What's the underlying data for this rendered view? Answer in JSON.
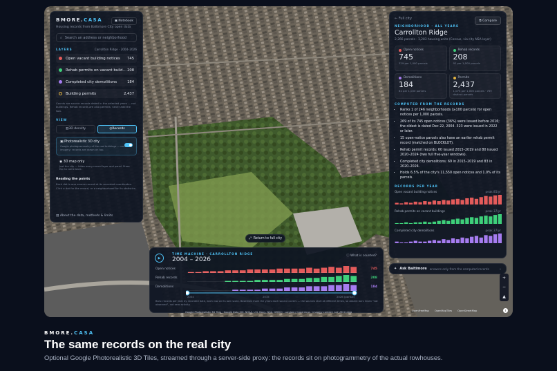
{
  "brand": {
    "first": "BMORE.",
    "second": "CASA"
  },
  "left_panel": {
    "notebook": "Notebook",
    "subtitle": "Housing records from Baltimore City open data",
    "search_placeholder": "Search an address or neighborhood",
    "layers_title": "LAYERS",
    "layers_scope": "Carrollton Ridge · 2004–2026",
    "layers": [
      {
        "label": "Open vacant building notices",
        "count": "745",
        "color": "#e45b5b"
      },
      {
        "label": "Rehab permits on vacant build…",
        "count": "208",
        "color": "#3ecf7a"
      },
      {
        "label": "Completed city demolitions",
        "count": "184",
        "color": "#a67cf0"
      },
      {
        "label": "Building permits",
        "count": "2,437",
        "color": "#e3b341"
      }
    ],
    "layers_note": "Counts are source records dated in the selected years — not buildings. Rehab records are also permits; never add the two.",
    "view_title": "VIEW",
    "view_tabs": [
      "3D density",
      "Records"
    ],
    "photo_title": "Photorealistic 3D city",
    "photo_desc": "Google photogrammetry of the real buildings — context imagery; records are drawn on top.",
    "map_only_title": "3D map only",
    "map_only_desc": "Just the city — hides every record layer and panel. Press Esc to come back.",
    "reading_title": "Reading the points",
    "reading_desc": "Each dot is one source record at its recorded coordinates. Click a dot for the record, or a neighborhood for its statistics.",
    "about": "About the data, methods & limits"
  },
  "right_panel": {
    "back": "Full city",
    "compare": "Compare",
    "tag": "NEIGHBORHOOD · ALL YEARS",
    "name": "Carrollton Ridge",
    "sub": "2,266 parcels · 1,283 housing units (Census, via city NSA layer)",
    "cards": [
      {
        "label": "Open notices",
        "value": "745",
        "sub": "329 per 1,000 parcels",
        "color": "#e45b5b"
      },
      {
        "label": "Rehab records",
        "value": "208",
        "sub": "92 per 1,000 parcels",
        "color": "#3ecf7a"
      },
      {
        "label": "Demolitions",
        "value": "184",
        "sub": "81 per 1,000 parcels",
        "color": "#a67cf0"
      },
      {
        "label": "Permits",
        "value": "2,437",
        "sub": "1,075 per 1,000 parcels · 769 distinct parcels",
        "color": "#e3b341"
      }
    ],
    "computed_title": "COMPUTED FROM THE RECORDS",
    "facts": [
      "Ranks 1 of 246 neighborhoods (≥100 parcels) for open notices per 1,000 parcels.",
      "269 of its 745 open notices (36%) were issued before 2016; the oldest is dated Dec 22, 2004. 323 were issued in 2022 or later.",
      "15 open-notice parcels also have an earlier rehab permit record (matched on BLOCKLOT).",
      "Rehab permit records: 60 issued 2015–2019 and 80 issued 2020–2024 (two full five-year windows).",
      "Completed city demolitions: 69 in 2015–2019 and 83 in 2020–2024.",
      "Holds 6.5% of the city's 11,550 open notices and 1.0% of its parcels."
    ],
    "per_year_title": "RECORDS PER YEAR",
    "sparks": [
      {
        "label": "Open vacant building notices",
        "peak": "peak 85/yr",
        "color": "#e45b5b",
        "values": [
          3,
          2,
          4,
          3,
          5,
          4,
          6,
          5,
          7,
          6,
          8,
          7,
          9,
          10,
          8,
          11,
          12,
          10,
          13,
          15,
          14,
          16,
          17
        ]
      },
      {
        "label": "Rehab permits on vacant buildings",
        "peak": "peak 37/yr",
        "color": "#3ecf7a",
        "values": [
          1,
          1,
          2,
          1,
          2,
          2,
          3,
          2,
          3,
          4,
          5,
          4,
          6,
          7,
          6,
          8,
          9,
          8,
          10,
          11,
          10,
          12,
          13
        ]
      },
      {
        "label": "Completed city demolitions",
        "peak": "peak 37/yr",
        "color": "#a67cf0",
        "values": [
          2,
          1,
          1,
          2,
          3,
          2,
          2,
          3,
          4,
          3,
          5,
          4,
          6,
          5,
          7,
          6,
          8,
          9,
          7,
          10,
          9,
          11,
          12
        ]
      }
    ]
  },
  "time_machine": {
    "tag": "TIME MACHINE · CARROLLTON RIDGE",
    "years": "2004 – 2026",
    "what": "What is counted?",
    "rows": [
      {
        "label": "Open notices",
        "total": "745",
        "color": "#e45b5b",
        "values": [
          1,
          1,
          2,
          2,
          2,
          3,
          3,
          3,
          4,
          4,
          4,
          4,
          5,
          5,
          5,
          5,
          6,
          5,
          6,
          7,
          6,
          8,
          7
        ]
      },
      {
        "label": "Rehab records",
        "total": "208",
        "color": "#3ecf7a",
        "values": [
          0,
          0,
          0,
          0,
          0,
          1,
          1,
          1,
          1,
          2,
          2,
          2,
          2,
          3,
          3,
          3,
          4,
          4,
          5,
          5,
          6,
          7,
          6
        ]
      },
      {
        "label": "Demolitions",
        "total": "184",
        "color": "#a67cf0",
        "values": [
          0,
          0,
          0,
          0,
          0,
          0,
          1,
          1,
          1,
          1,
          2,
          2,
          2,
          3,
          3,
          3,
          4,
          4,
          4,
          5,
          5,
          6,
          5
        ]
      }
    ],
    "ticks": [
      "2004",
      "2015",
      "2026 (partial)"
    ],
    "note": "Bars: records per year by recorded date, each row on its own scale. Baselines mark the years each source covers — the sources start at different times, so absent bars mean \"not observed\", not zero activity."
  },
  "return_label": "Return to full city",
  "ask": {
    "label": "Ask Baltimore",
    "hint": "answers only from the computed records"
  },
  "attribution": "Google Photorealistic 3D Tiles · Google Data SIO, NOAA, U.S. Navy, NGA, GEBCO · Landsat / Copernicus · imagery context; not UHCU data",
  "map_links": [
    "OpenFreeMap",
    "OpenMapTiles",
    "OpenStreetMap"
  ],
  "caption": {
    "kicker_a": "BMORE.",
    "kicker_b": "CASA",
    "title": "The same records on the real city",
    "desc": "Optional Google Photorealistic 3D Tiles, streamed through a server-side proxy: the records sit on photogrammetry of the actual rowhouses."
  }
}
